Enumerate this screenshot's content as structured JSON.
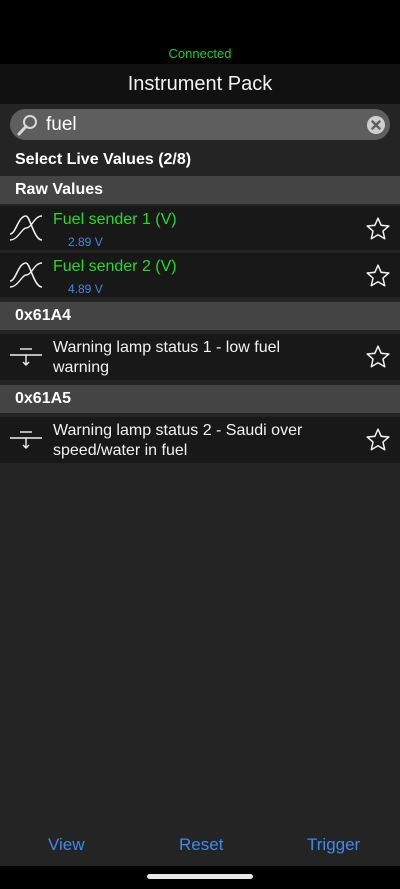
{
  "status": {
    "connection": "Connected"
  },
  "header": {
    "title": "Instrument Pack"
  },
  "search": {
    "value": "fuel"
  },
  "list": {
    "heading": "Select Live Values (2/8)",
    "sections": [
      {
        "title": "Raw Values",
        "items": [
          {
            "label": "Fuel sender 1 (V)",
            "value": "2.89 V"
          },
          {
            "label": "Fuel sender 2 (V)",
            "value": "4.89 V"
          }
        ]
      },
      {
        "title": "0x61A4",
        "items": [
          {
            "label_line1": "Warning lamp status 1 - low fuel",
            "label_line2": "warning"
          }
        ]
      },
      {
        "title": "0x61A5",
        "items": [
          {
            "label_line1": "Warning lamp status 2 - Saudi over",
            "label_line2": "speed/water in fuel"
          }
        ]
      }
    ]
  },
  "footer": {
    "view": "View",
    "reset": "Reset",
    "trigger": "Trigger"
  },
  "icons": {
    "analog_item": "sine-wave-icon",
    "digital_item": "switch-icon",
    "favorite": "star-outline-icon",
    "search": "magnifier-icon",
    "clear": "clear-circle-icon"
  },
  "colors": {
    "connected": "#22cc22",
    "active_label": "#22dd22",
    "value": "#3f8ae8",
    "accent": "#3f8ae8",
    "section_bg": "#444444",
    "row_bg": "#181818"
  }
}
